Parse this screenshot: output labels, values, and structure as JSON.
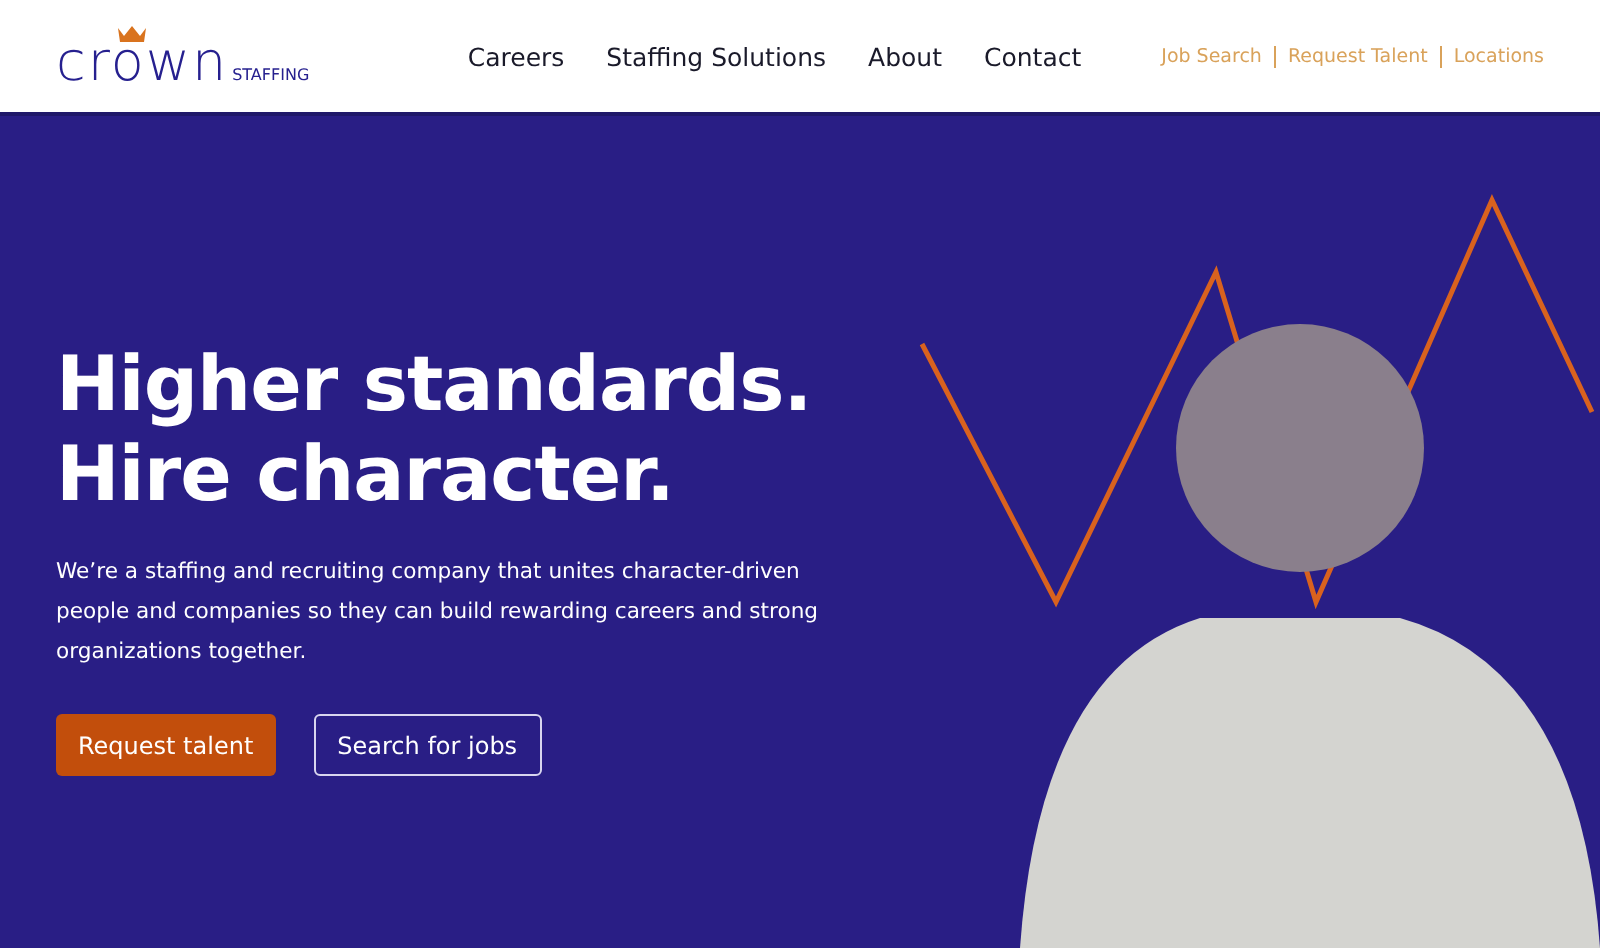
{
  "logo": {
    "wordmark": "crown",
    "tagline": "STAFFING"
  },
  "nav": [
    {
      "label": "Careers"
    },
    {
      "label": "Staffing Solutions"
    },
    {
      "label": "About"
    },
    {
      "label": "Contact"
    }
  ],
  "utility_links": [
    {
      "label": "Job Search"
    },
    {
      "label": "Request Talent"
    },
    {
      "label": "Locations"
    }
  ],
  "hero": {
    "headline": [
      "Higher standards.",
      "Hire character."
    ],
    "description": "We’re a staffing and recruiting company that unites character-driven people and companies so they can build rewarding careers and strong organizations together.",
    "buttons": [
      {
        "label": "Request talent",
        "kind": "primary"
      },
      {
        "label": "Search for jobs",
        "kind": "outline"
      }
    ]
  }
}
